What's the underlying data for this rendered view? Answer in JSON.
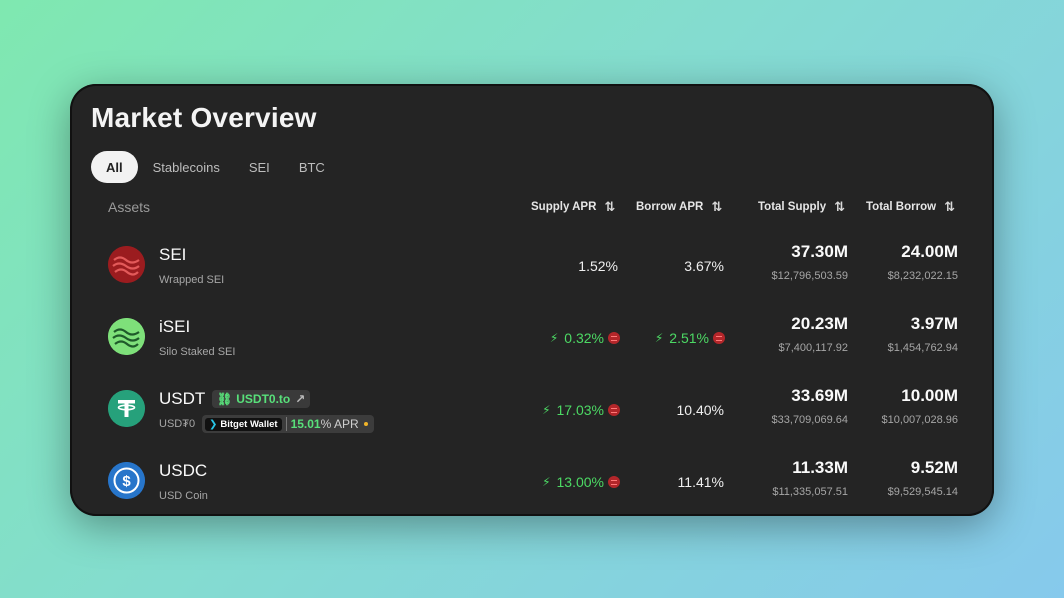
{
  "title": "Market Overview",
  "tabs": [
    "All",
    "Stablecoins",
    "SEI",
    "BTC"
  ],
  "headers": {
    "assets": "Assets",
    "supply_apr": "Supply APR",
    "borrow_apr": "Borrow APR",
    "total_supply": "Total Supply",
    "total_borrow": "Total Borrow",
    "sort_icon": "⇅"
  },
  "rows": [
    {
      "symbol": "SEI",
      "name": "Wrapped SEI",
      "supply_apr": "1.52%",
      "borrow_apr": "3.67%",
      "total_supply": "37.30M",
      "total_supply_usd": "$12,796,503.59",
      "total_borrow": "24.00M",
      "total_borrow_usd": "$8,232,022.15"
    },
    {
      "symbol": "iSEI",
      "name": "Silo Staked SEI",
      "supply_apr": "0.32%",
      "borrow_apr": "2.51%",
      "total_supply": "20.23M",
      "total_supply_usd": "$7,400,117.92",
      "total_borrow": "3.97M",
      "total_borrow_usd": "$1,454,762.94"
    },
    {
      "symbol": "USDT",
      "name": "USD₮0",
      "supply_apr": "17.03%",
      "borrow_apr": "10.40%",
      "total_supply": "33.69M",
      "total_supply_usd": "$33,709,069.64",
      "total_borrow": "10.00M",
      "total_borrow_usd": "$10,007,028.96",
      "link_badge": "USDT0.to",
      "bitget_label": "Bitget Wallet",
      "bitget_apr": "15.01",
      "bitget_apr_suffix": "% APR"
    },
    {
      "symbol": "USDC",
      "name": "USD Coin",
      "supply_apr": "13.00%",
      "borrow_apr": "11.41%",
      "total_supply": "11.33M",
      "total_supply_usd": "$11,335,057.51",
      "total_borrow": "9.52M",
      "total_borrow_usd": "$9,529,545.14"
    }
  ],
  "colors": {
    "accent_green": "#4cd964",
    "card_bg": "#242424",
    "usdt_green": "#26a17b",
    "usdc_blue": "#2775ca",
    "sei_red": "#9b1c1f",
    "isei_green": "#7ee07a"
  }
}
